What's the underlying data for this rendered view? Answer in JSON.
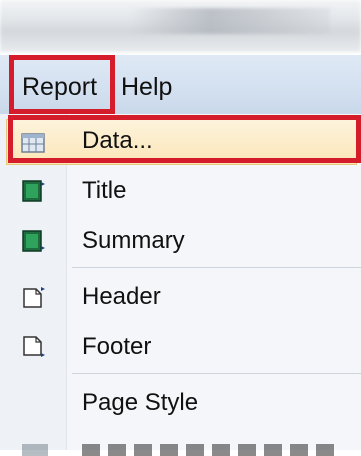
{
  "menubar": {
    "items": [
      {
        "label": "Report"
      },
      {
        "label": "Help"
      }
    ]
  },
  "report_menu": {
    "items": [
      {
        "label": "Data...",
        "icon": "data-table-icon",
        "highlighted": true
      },
      {
        "label": "Title",
        "icon": "title-band-icon"
      },
      {
        "label": "Summary",
        "icon": "summary-band-icon"
      },
      {
        "label": "Header",
        "icon": "page-header-icon"
      },
      {
        "label": "Footer",
        "icon": "page-footer-icon"
      },
      {
        "label": "Page Style"
      }
    ]
  },
  "colors": {
    "highlight_border": "#d41c2a",
    "menubar_bg": "#d3e0f0",
    "hover_bg": "#fbe6b8"
  }
}
